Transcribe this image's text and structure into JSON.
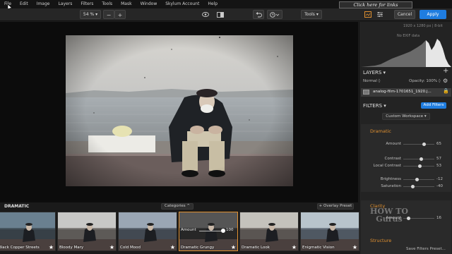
{
  "menu": [
    "File",
    "Edit",
    "Image",
    "Layers",
    "Filters",
    "Tools",
    "Mask",
    "Window",
    "Skylum Account",
    "Help"
  ],
  "banner": "Click here for links",
  "toolbar": {
    "zoom": "54 %",
    "zoom_out": "−",
    "zoom_in": "+",
    "tools": "Tools",
    "cancel": "Cancel",
    "apply": "Apply"
  },
  "image_info": {
    "size": "1920 x 1280 px | 8-bit",
    "exif": "No EXIF data"
  },
  "layers": {
    "title": "LAYERS",
    "blend": "Normal",
    "opacity": "Opacity: 100%",
    "layer_name": "analog-film-1701651_1920.j..."
  },
  "filters": {
    "title": "FILTERS",
    "add": "Add Filters",
    "workspace": "Custom Workspace"
  },
  "dramatic": {
    "title": "Dramatic",
    "sliders": [
      {
        "label": "Amount",
        "value": 65
      },
      {
        "label": "Contrast",
        "value": 57
      },
      {
        "label": "Local Contrast",
        "value": 53
      },
      {
        "label": "Brightness",
        "value": -12
      },
      {
        "label": "Saturation",
        "value": -40
      }
    ]
  },
  "clarity": {
    "title": "Clarity",
    "amount_label": "Amount",
    "amount": 16
  },
  "structure": {
    "title": "Structure"
  },
  "save_preset": "Save Filters Preset...",
  "watermark": "HOW TO Gurus",
  "strip": {
    "title": "DRAMATIC",
    "categories": "Categories",
    "overlay": "+ Overlay Preset",
    "selected_amount_label": "Amount",
    "selected_amount": 100,
    "presets": [
      "Black Copper Streets",
      "Bloody Mary",
      "Cold Mood",
      "Dramatic Grungy",
      "Dramatic Look",
      "Enigmatic Vision"
    ]
  },
  "colors": {
    "accent": "#1f7de0",
    "orange": "#e09030"
  }
}
